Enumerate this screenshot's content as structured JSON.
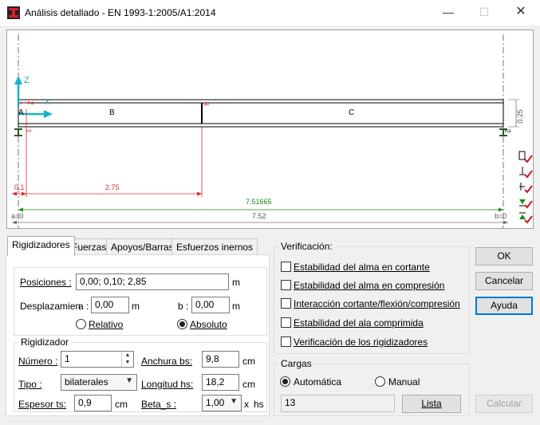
{
  "window": {
    "title": "Análisis detallado - EN 1993-1:2005/A1:2014"
  },
  "canvas": {
    "axis_z": "Z",
    "axis_x": "X",
    "support_left": "A",
    "stiffener_labels": [
      "1",
      "2",
      "3"
    ],
    "panel_labels": [
      "B",
      "C"
    ],
    "dim_height": "0.25",
    "support_right_num": "2",
    "support_left_num": "1",
    "dim_positions": [
      "0.1",
      "2.75"
    ],
    "dim_span": "7.51665",
    "dim_total": "7.52",
    "dim_a": "a=0",
    "dim_b": "b=0"
  },
  "tabs": [
    "Rigidizadores",
    "Fuerzas",
    "Apoyos/Barras",
    "Esfuerzos inernos"
  ],
  "rigidizadores": {
    "posiciones_label": "Posiciones :",
    "posiciones_value": "0,00; 0,10; 2,85",
    "posiciones_unit": "m",
    "desplazamiento_label": "Desplazamien",
    "a_label": "a :",
    "a_value": "0,00",
    "a_unit": "m",
    "b_label": "b :",
    "b_value": "0,00",
    "b_unit": "m",
    "relativo": "Relativo",
    "absoluto": "Absoluto",
    "group_label": "Rigidizador",
    "numero_label": "Número :",
    "numero_value": "1",
    "anchura_label": "Anchura bs:",
    "anchura_value": "9,8",
    "anchura_unit": "cm",
    "tipo_label": "Tipo :",
    "tipo_value": "bilaterales",
    "longitud_label": "Longitud hs:",
    "longitud_value": "18,2",
    "longitud_unit": "cm",
    "espesor_label": "Espesor ts:",
    "espesor_value": "0,9",
    "espesor_unit": "cm",
    "beta_label": "Beta_s :",
    "beta_value": "1,00",
    "beta_unit1": "x",
    "beta_unit2": "hs"
  },
  "verificacion": {
    "label": "Verificación:",
    "items": [
      "Estabilidad del alma en cortante",
      "Estabilidad del alma en compresión",
      "Interacción cortante/flexión/compresión",
      "Estabilidad del ala comprimida",
      "Verificación de los rigidizadores"
    ]
  },
  "cargas": {
    "label": "Cargas",
    "automatica": "Automática",
    "manual": "Manual",
    "value": "13",
    "lista": "Lista"
  },
  "buttons": {
    "ok": "OK",
    "cancelar": "Cancelar",
    "ayuda": "Ayuda",
    "calcular": "Calcular"
  },
  "colors": {
    "dim_red": "#e0262e",
    "dim_green": "#139013",
    "axis_cyan": "#16b5c8",
    "check_red": "#d0141b"
  }
}
